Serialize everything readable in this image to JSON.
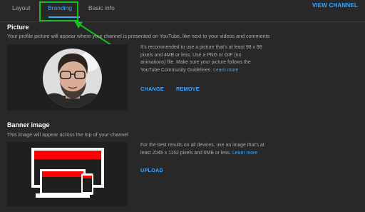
{
  "tabs": [
    {
      "label": "Layout"
    },
    {
      "label": "Branding"
    },
    {
      "label": "Basic info"
    }
  ],
  "header": {
    "view_channel": "VIEW CHANNEL"
  },
  "picture": {
    "title": "Picture",
    "description": "Your profile picture will appear where your channel is presented on YouTube, like next to your videos and comments",
    "info_line1": "It’s recommended to use a picture that’s at least 98 x 98",
    "info_line2": "pixels and 4MB or less. Use a PNG or GIF (no",
    "info_line3": "animations) file. Make sure your picture follows the",
    "info_line4": "YouTube Community Guidelines.",
    "learn_more": "Learn more",
    "change": "CHANGE",
    "remove": "REMOVE"
  },
  "banner": {
    "title": "Banner image",
    "description": "This image will appear across the top of your channel",
    "info_line1": "For the best results on all devices, use an image that’s at",
    "info_line2": "least 2048 x 1152 pixels and 6MB or less.",
    "learn_more": "Learn more",
    "upload": "UPLOAD"
  },
  "colors": {
    "accent": "#3ea6ff",
    "highlight": "#12c21a",
    "banner_red": "#ff0000",
    "background": "#282828"
  }
}
